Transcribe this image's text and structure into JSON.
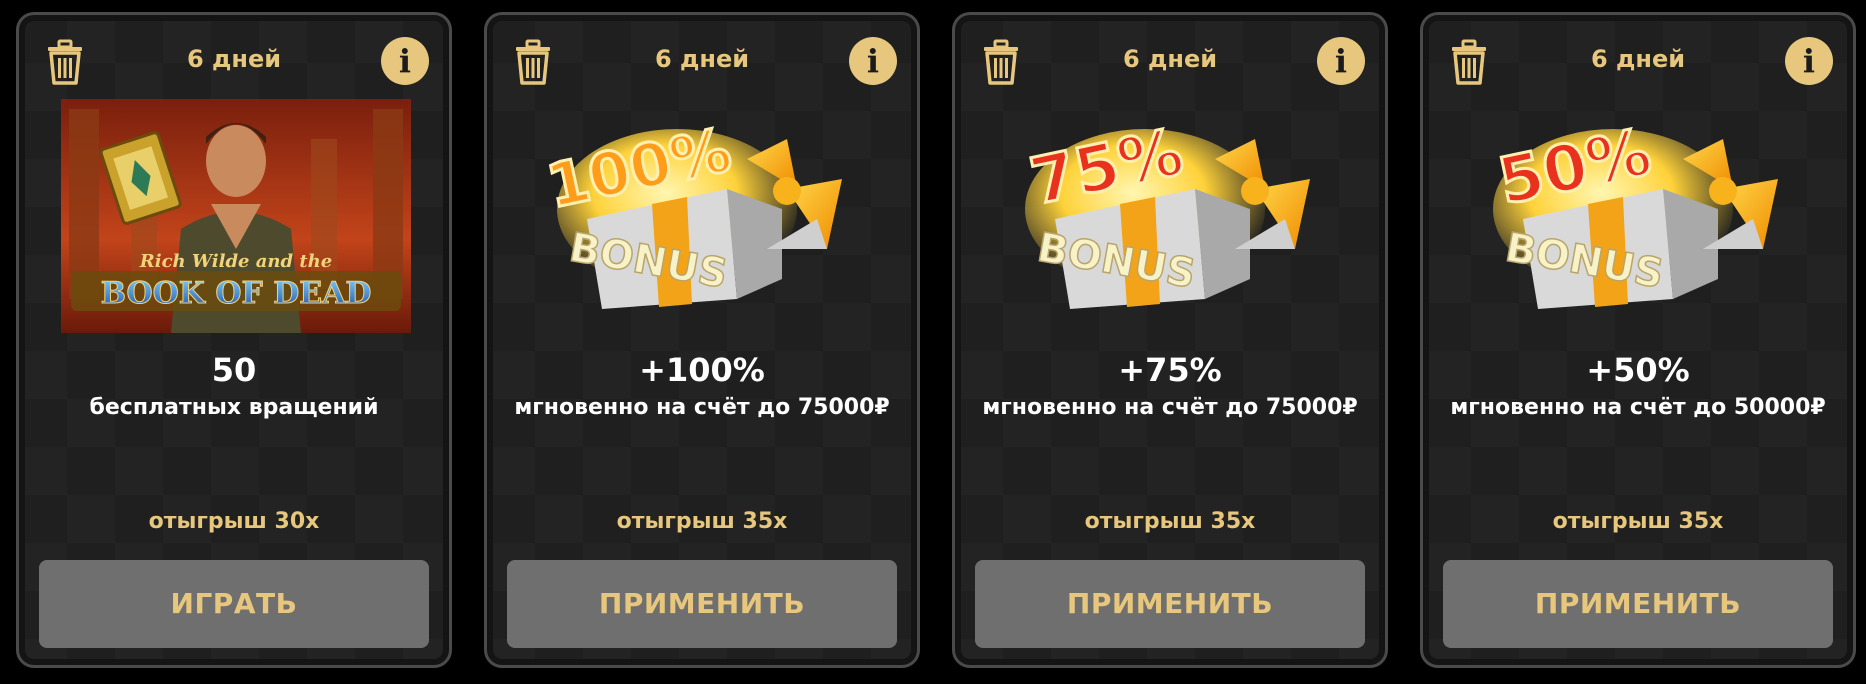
{
  "cards": [
    {
      "days": "6 дней",
      "amount": "50",
      "description": "бесплатных вращений",
      "wager": "отыгрыш 30x",
      "button_label": "ИГРАТЬ",
      "image": {
        "kind": "game",
        "line1": "Rich Wilde and the",
        "line2": "BOOK OF DEAD"
      }
    },
    {
      "days": "6 дней",
      "amount": "+100%",
      "description": "мгновенно на счёт до 75000₽",
      "wager": "отыгрыш 35x",
      "button_label": "ПРИМЕНИТЬ",
      "image": {
        "kind": "bonus-box",
        "percent": "100%",
        "box_text": "BONUS"
      }
    },
    {
      "days": "6 дней",
      "amount": "+75%",
      "description": "мгновенно на счёт до 75000₽",
      "wager": "отыгрыш 35x",
      "button_label": "ПРИМЕНИТЬ",
      "image": {
        "kind": "bonus-box",
        "percent": "75%",
        "box_text": "BONUS"
      }
    },
    {
      "days": "6 дней",
      "amount": "+50%",
      "description": "мгновенно на счёт до 50000₽",
      "wager": "отыгрыш 35x",
      "button_label": "ПРИМЕНИТЬ",
      "image": {
        "kind": "bonus-box",
        "percent": "50%",
        "box_text": "BONUS"
      }
    }
  ],
  "icons": {
    "delete": "trash-icon",
    "info": "info-icon",
    "info_glyph": "i"
  },
  "colors": {
    "accent": "#e7c77d",
    "card_bg": "#1f1f1f",
    "button_bg": "#6f6f6f",
    "text": "#ffffff"
  }
}
